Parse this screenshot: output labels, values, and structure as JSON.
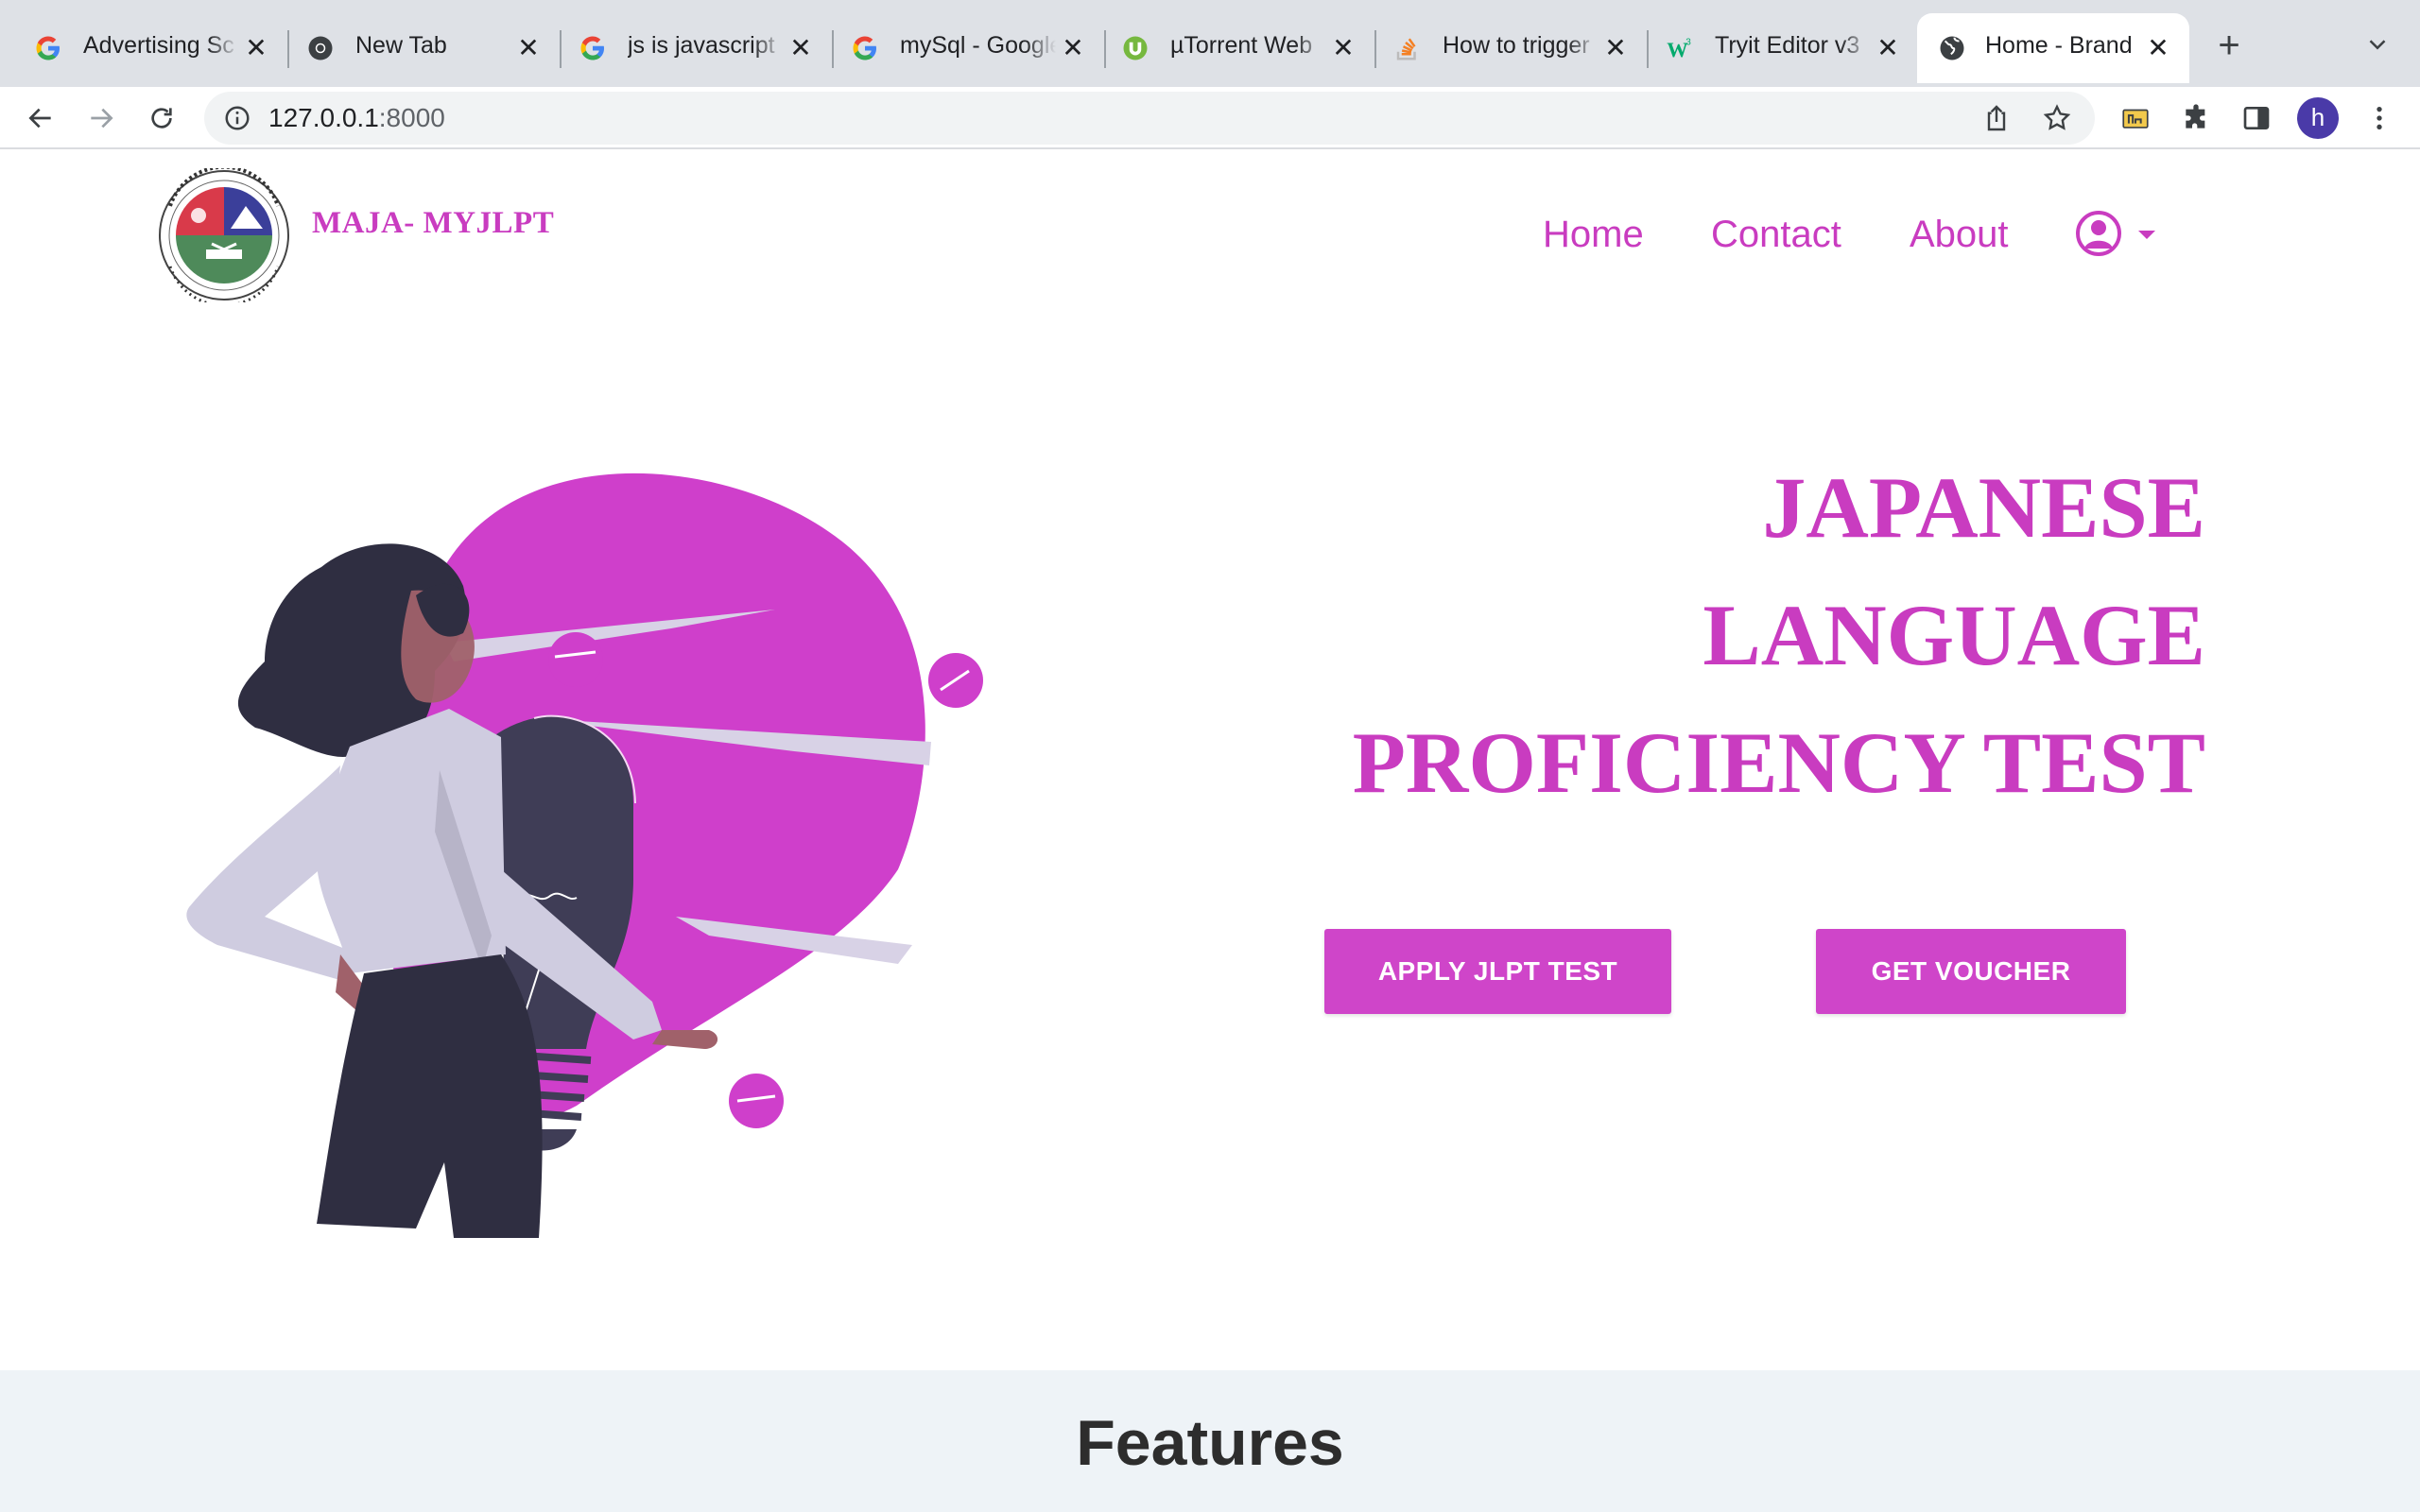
{
  "browser": {
    "tabs": [
      {
        "title": "Advertising Sc",
        "icon": "google-icon"
      },
      {
        "title": "New Tab",
        "icon": "chrome-icon"
      },
      {
        "title": "js is javascript",
        "icon": "google-icon"
      },
      {
        "title": "mySql - Google",
        "icon": "google-icon"
      },
      {
        "title": "µTorrent Web",
        "icon": "utorrent-icon"
      },
      {
        "title": "How to trigger",
        "icon": "stackoverflow-icon"
      },
      {
        "title": "Tryit Editor v3",
        "icon": "w3schools-icon"
      },
      {
        "title": "Home - Brand",
        "icon": "globe-icon",
        "active": true
      }
    ],
    "address": {
      "host": "127.0.0.1",
      "port": ":8000"
    },
    "profile_initial": "h"
  },
  "site": {
    "brand": "MAJA- MYJLPT",
    "nav": [
      "Home",
      "Contact",
      "About"
    ],
    "headline": [
      "JAPANESE",
      "LANGUAGE",
      "PROFICIENCY TEST"
    ],
    "buttons": {
      "apply": "APPLY JLPT TEST",
      "voucher": "GET VOUCHER"
    },
    "features_title": "Features"
  },
  "colors": {
    "accent": "#c93cc0",
    "button": "#cf45c9",
    "features_bg": "#eef3f7",
    "figure_dark": "#2f2e41",
    "shirt": "#cfcce0"
  }
}
